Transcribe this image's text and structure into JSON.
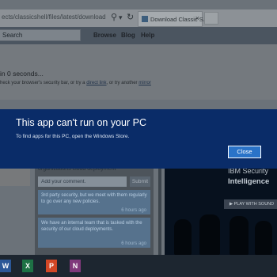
{
  "browser": {
    "url": "ects/classicshell/files/latest/download",
    "tab_title": "Download Classic S...",
    "tab_close": "×",
    "search_glyph": "⚲",
    "dropdown_glyph": "▾",
    "refresh_glyph": "↻"
  },
  "site": {
    "search_placeholder": "Search",
    "nav": [
      "Browse",
      "Blog",
      "Help"
    ]
  },
  "notice": {
    "countdown": "in 0 seconds...",
    "hint_prefix": "heck your browser's security bar, or try a ",
    "direct_link": "direct link",
    "hint_mid": ", or try another ",
    "mirror_link": "mirror"
  },
  "dialog": {
    "title": "This app can't run on your PC",
    "message": "To find apps for this PC, open the Windows Store.",
    "close_label": "Close"
  },
  "comments": {
    "heading": "organizations cloud deployment",
    "input_placeholder": "Add your comment.",
    "submit_label": "Submit",
    "items": [
      {
        "text": "3rd party security, but we meet with them regularly to go over any new policies.",
        "time": "6 hours ago"
      },
      {
        "text": "We have an internal team that is tasked with the security of our cloud deployments.",
        "time": "6 hours ago"
      }
    ]
  },
  "ad": {
    "title": "IBM Security",
    "subtitle": "Intelligence",
    "play_label": "▶ PLAY WITH SOUND"
  },
  "taskbar": {
    "items": [
      {
        "name": "word-icon",
        "glyph": "W",
        "color": "#2b5797"
      },
      {
        "name": "excel-icon",
        "glyph": "X",
        "color": "#1e7145"
      },
      {
        "name": "powerpoint-icon",
        "glyph": "P",
        "color": "#d24726"
      },
      {
        "name": "onenote-icon",
        "glyph": "N",
        "color": "#80397b"
      }
    ]
  }
}
